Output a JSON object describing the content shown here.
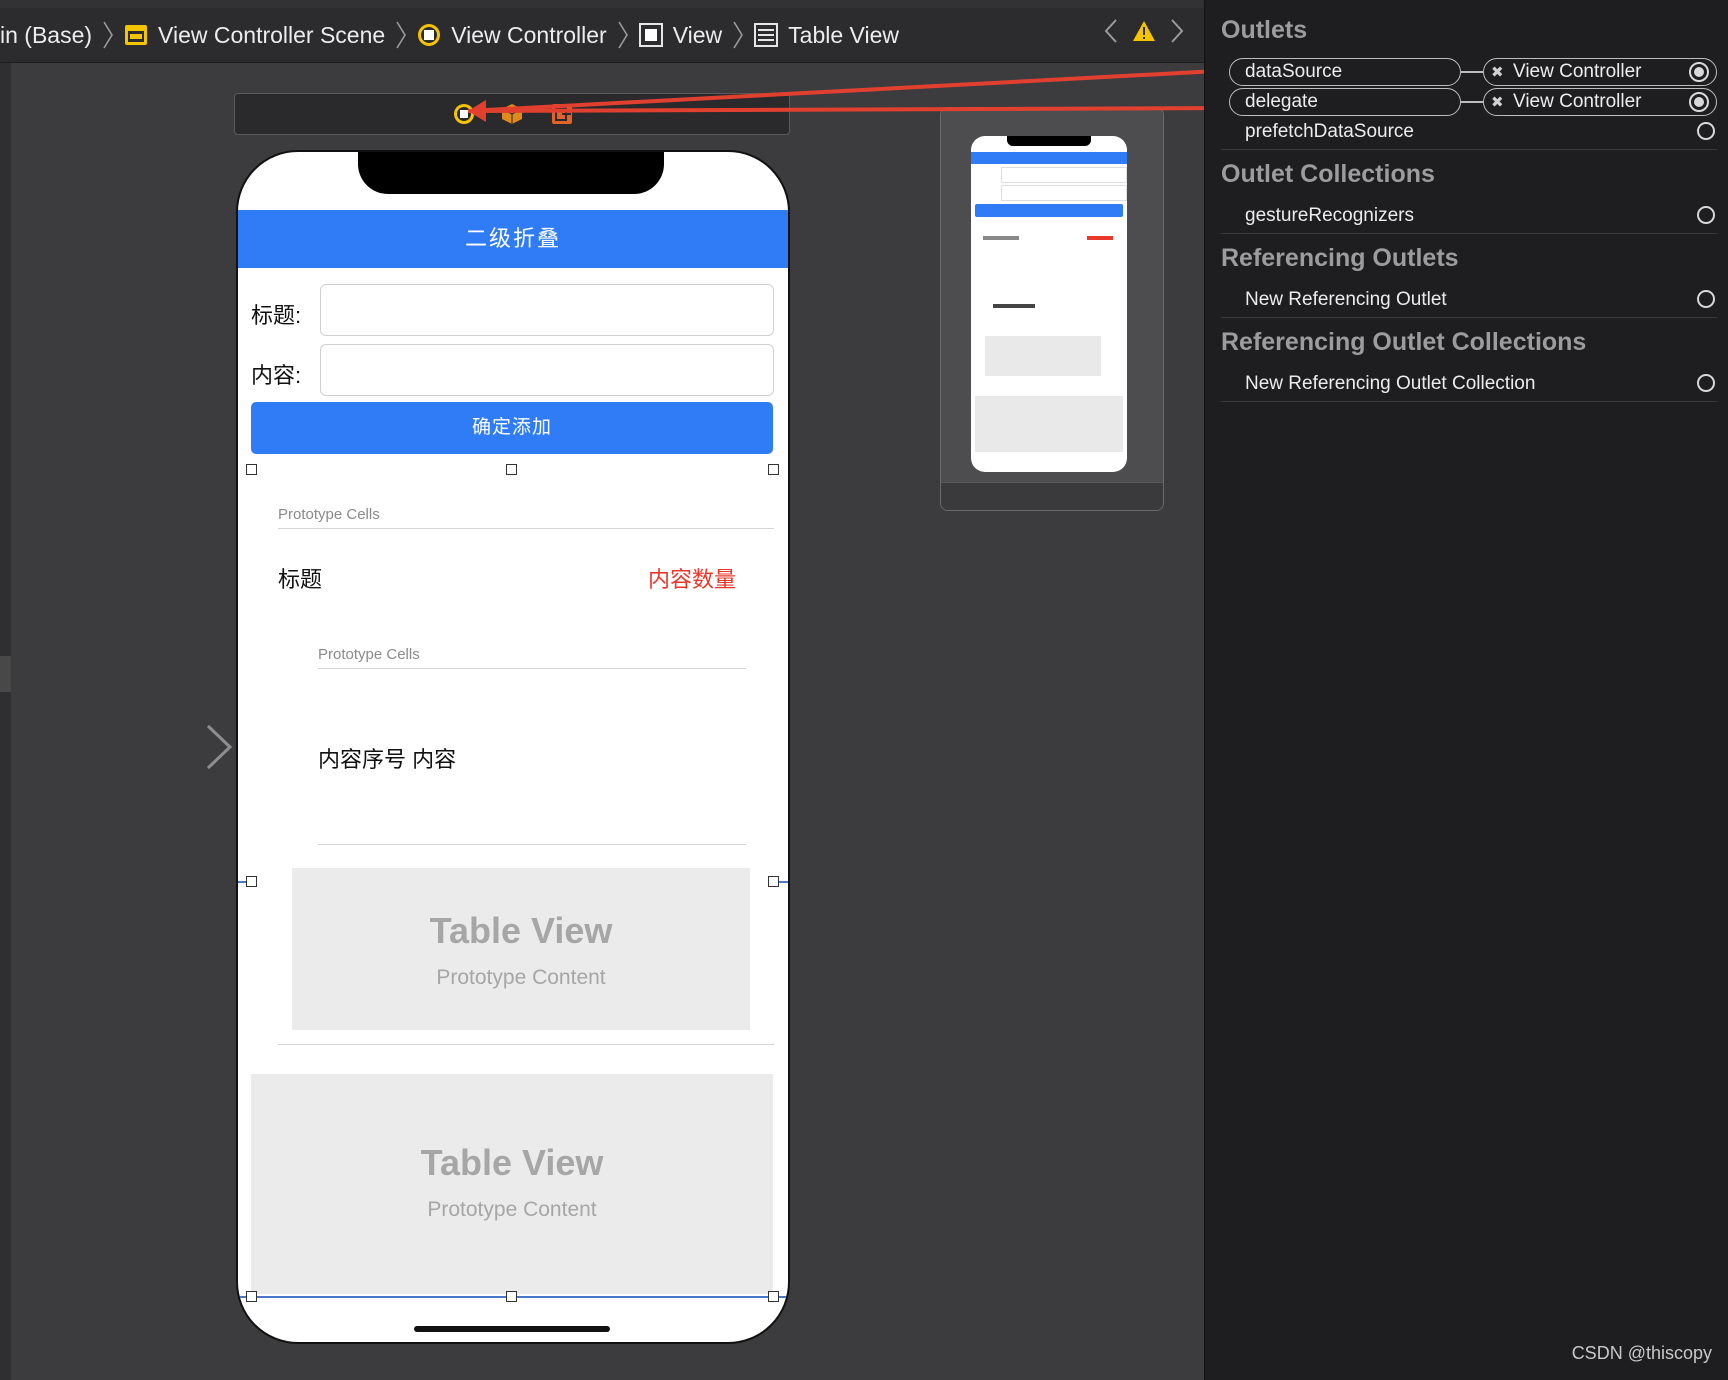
{
  "breadcrumb": {
    "items": [
      {
        "label": "in (Base)",
        "icon": "none"
      },
      {
        "label": "View Controller Scene",
        "icon": "scene-icon"
      },
      {
        "label": "View Controller",
        "icon": "view-controller-icon"
      },
      {
        "label": "View",
        "icon": "view-icon"
      },
      {
        "label": "Table View",
        "icon": "table-view-icon"
      }
    ],
    "warning_icon": "warning-icon"
  },
  "phone": {
    "nav_title": "二级折叠",
    "title_label": "标题:",
    "content_label": "内容:",
    "add_button": "确定添加",
    "outer_proto_header": "Prototype Cells",
    "cell_title": "标题",
    "cell_count": "内容数量",
    "inner_proto_header": "Prototype Cells",
    "inner_cell_text": "内容序号  内容",
    "inner_tableview_title": "Table View",
    "inner_tableview_sub": "Prototype Content",
    "outer_tableview_title": "Table View",
    "outer_tableview_sub": "Prototype Content"
  },
  "inspector": {
    "outlets_header": "Outlets",
    "outlets": [
      {
        "name": "dataSource",
        "target": "View Controller",
        "connected": true
      },
      {
        "name": "delegate",
        "target": "View Controller",
        "connected": true
      },
      {
        "name": "prefetchDataSource",
        "target": "",
        "connected": false
      }
    ],
    "outlet_collections_header": "Outlet Collections",
    "outlet_collections": [
      {
        "name": "gestureRecognizers"
      }
    ],
    "referencing_outlets_header": "Referencing Outlets",
    "referencing_outlets": [
      {
        "name": "New Referencing Outlet"
      }
    ],
    "referencing_collections_header": "Referencing Outlet Collections",
    "referencing_collections": [
      {
        "name": "New Referencing Outlet Collection"
      }
    ]
  },
  "watermark": "CSDN @thiscopy",
  "colors": {
    "nav_blue": "#2f7cf6",
    "red_label": "#e8382c",
    "arrow_red": "#e2402f",
    "warning": "#f5c400"
  }
}
